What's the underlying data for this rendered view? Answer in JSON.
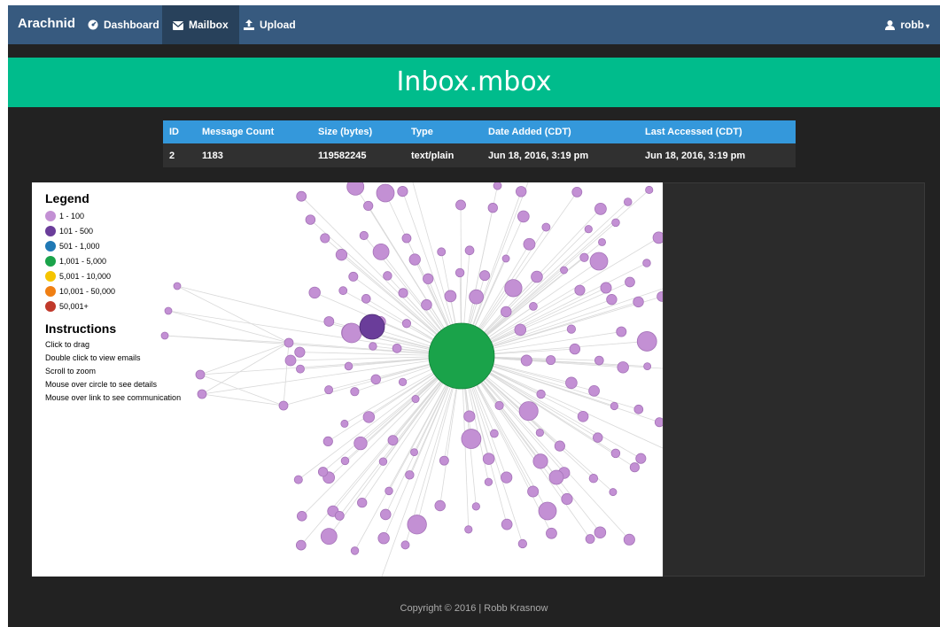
{
  "navbar": {
    "brand": "Arachnid",
    "items": [
      {
        "label": "Dashboard",
        "icon": "dashboard-icon"
      },
      {
        "label": "Mailbox",
        "icon": "envelope-icon",
        "active": true
      },
      {
        "label": "Upload",
        "icon": "upload-icon"
      }
    ],
    "user": {
      "label": "robb",
      "icon": "user-icon"
    }
  },
  "banner": {
    "title": "Inbox.mbox"
  },
  "mailbox_table": {
    "columns": [
      "ID",
      "Message Count",
      "Size (bytes)",
      "Type",
      "Date Added (CDT)",
      "Last Accessed (CDT)"
    ],
    "row": [
      "2",
      "1183",
      "119582245",
      "text/plain",
      "Jun 18, 2016, 3:19 pm",
      "Jun 18, 2016, 3:19 pm"
    ]
  },
  "legend": {
    "title": "Legend",
    "items": [
      {
        "label": "1 - 100",
        "color": "#c390d4"
      },
      {
        "label": "101 - 500",
        "color": "#6a3d9a"
      },
      {
        "label": "501 - 1,000",
        "color": "#1f78b4"
      },
      {
        "label": "1,001 - 5,000",
        "color": "#1aa34a"
      },
      {
        "label": "5,001 - 10,000",
        "color": "#f5c400"
      },
      {
        "label": "10,001 - 50,000",
        "color": "#f07f13"
      },
      {
        "label": "50,001+",
        "color": "#c0392b"
      }
    ]
  },
  "instructions": {
    "title": "Instructions",
    "lines": [
      "Click to drag",
      "Double click to view emails",
      "Scroll to zoom",
      "Mouse over circle to see details",
      "Mouse over link to see communication"
    ]
  },
  "graph": {
    "hub_color": "#1aa34a",
    "node_color": "#c390d4",
    "mid_node_color": "#6a3d9a",
    "link_color": "#d9d9d9"
  },
  "footer": {
    "text": "Copyright © 2016 | Robb Krasnow"
  }
}
